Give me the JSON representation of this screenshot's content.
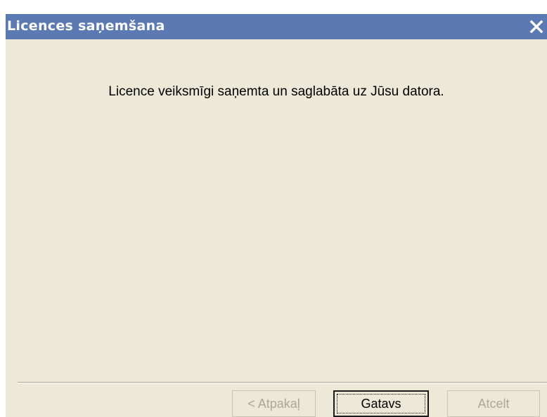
{
  "window": {
    "title": "Licences saņemšana",
    "close_icon": "close-icon"
  },
  "content": {
    "message": "Licence veiksmīgi saņemta un saglabāta uz Jūsu datora."
  },
  "buttons": {
    "back_label": "< Atpakaļ",
    "finish_label": "Gatavs",
    "cancel_label": "Atcelt"
  },
  "colors": {
    "titlebar": "#5b79b3",
    "dialog_background": "#ece9d8",
    "disabled_text": "#aca899"
  }
}
